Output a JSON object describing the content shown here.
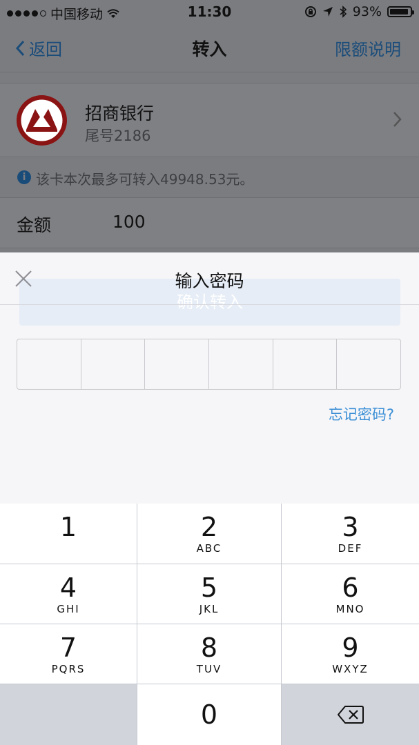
{
  "status_bar": {
    "carrier": "中国移动",
    "time": "11:30",
    "battery": "93%",
    "battery_level": 0.93
  },
  "nav": {
    "back_label": "返回",
    "title": "转入",
    "right_label": "限额说明"
  },
  "bank": {
    "name": "招商银行",
    "tail": "尾号2186"
  },
  "notice": {
    "text": "该卡本次最多可转入49948.53元。"
  },
  "amount": {
    "label": "金额",
    "value": "100"
  },
  "background_confirm": "确认转入",
  "password_sheet": {
    "title": "输入密码",
    "forgot": "忘记密码?",
    "pin_length": 6
  },
  "keypad": {
    "keys": [
      {
        "num": "1",
        "letters": ""
      },
      {
        "num": "2",
        "letters": "ABC"
      },
      {
        "num": "3",
        "letters": "DEF"
      },
      {
        "num": "4",
        "letters": "GHI"
      },
      {
        "num": "5",
        "letters": "JKL"
      },
      {
        "num": "6",
        "letters": "MNO"
      },
      {
        "num": "7",
        "letters": "PQRS"
      },
      {
        "num": "8",
        "letters": "TUV"
      },
      {
        "num": "9",
        "letters": "WXYZ"
      },
      {
        "num": "0",
        "letters": ""
      }
    ]
  },
  "colors": {
    "link": "#3b8fd6",
    "bank_logo": "#8a1313"
  }
}
